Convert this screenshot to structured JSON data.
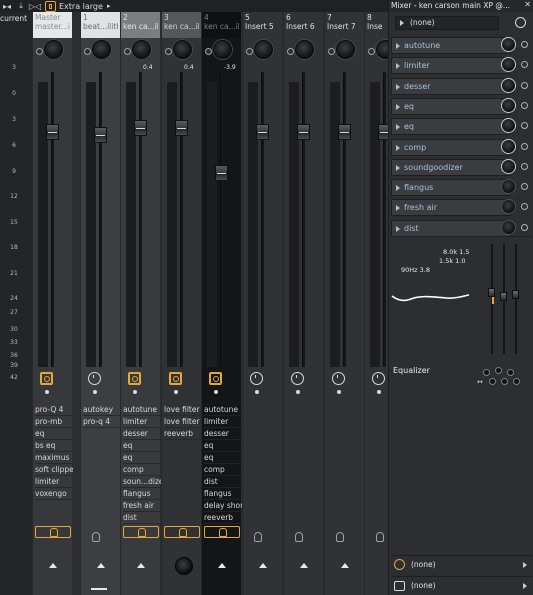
{
  "toolbar": {
    "icon1": "lock-bowtie-icon",
    "icon2": "download-icon",
    "icon3": "play-bowtie-icon",
    "size_label": "Extra large",
    "dropdown_arrow": "▸"
  },
  "scale": {
    "header": "current",
    "labels": [
      "3",
      "0",
      "3",
      "6",
      "9",
      "12",
      "15",
      "18",
      "21",
      "24",
      "27",
      "30",
      "33",
      "36",
      "39",
      "42"
    ]
  },
  "tracks": [
    {
      "num": "Master",
      "name": "master...ilith",
      "pan": "",
      "effects": [
        "pro-Q 4",
        "pro-mb",
        "eq",
        "bs eq",
        "maximus",
        "soft clipper",
        "limiter",
        "voxengo"
      ]
    },
    {
      "num": "1",
      "name": "beat...ilith",
      "pan": "",
      "effects": [
        "autokey",
        "pro-q 4"
      ]
    },
    {
      "num": "2",
      "name": "ken ca...ilith",
      "pan": "0.4",
      "effects": [
        "autotune",
        "limiter",
        "desser",
        "eq",
        "eq",
        "comp",
        "soun...dizer",
        "flangus",
        "fresh air",
        "dist"
      ]
    },
    {
      "num": "3",
      "name": "ken ca...ilith",
      "pan": "0.4",
      "effects": [
        "love filter",
        "love filter",
        "reeverb"
      ]
    },
    {
      "num": "4",
      "name": "ken ca...ilith",
      "pan": "-3.9",
      "effects": [
        "autotune",
        "limiter",
        "desser",
        "eq",
        "eq",
        "comp",
        "dist",
        "flangus",
        "delay short",
        "reeverb"
      ]
    },
    {
      "num": "5",
      "name": "Insert 5",
      "pan": "",
      "effects": []
    },
    {
      "num": "6",
      "name": "Insert 6",
      "pan": "",
      "effects": []
    },
    {
      "num": "7",
      "name": "Insert 7",
      "pan": "",
      "effects": []
    },
    {
      "num": "8",
      "name": "Inse",
      "pan": "",
      "effects": []
    }
  ],
  "scroll_next": "›",
  "panel": {
    "title": "Mixer - ken carson main XP @...",
    "close": "✕",
    "preset": "(none)",
    "slots": [
      "autotune",
      "limiter",
      "desser",
      "eq",
      "eq",
      "comp",
      "soundgoodizer",
      "flangus",
      "fresh air",
      "dist"
    ],
    "eq": {
      "band_hi": "8.0k 1.5",
      "band_mid": "1.5k 1.0",
      "band_lo": "90Hz 3.8",
      "label": "Equalizer"
    },
    "bottom1": "(none)",
    "bottom2": "(none)",
    "accent": "#e5a934"
  }
}
